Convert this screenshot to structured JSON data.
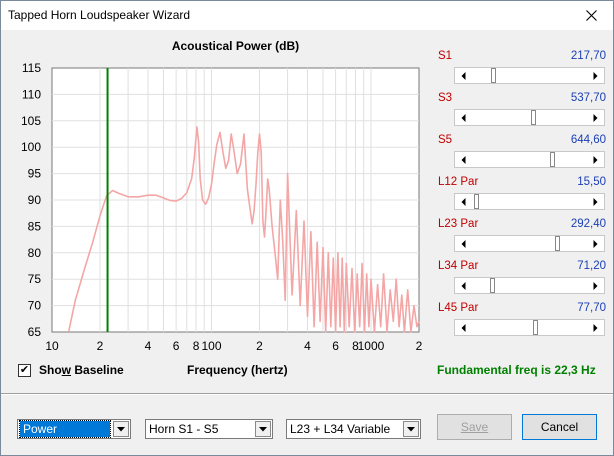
{
  "window": {
    "title": "Tapped Horn Loudspeaker Wizard"
  },
  "chart_data": {
    "type": "line",
    "title": "Acoustical Power (dB)",
    "xlabel": "Frequency (hertz)",
    "ylabel": "",
    "xscale": "log",
    "xlim": [
      10,
      2000
    ],
    "ylim": [
      65,
      115
    ],
    "yticks": [
      115,
      110,
      105,
      100,
      95,
      90,
      85,
      80,
      75,
      70,
      65
    ],
    "xtick_labels": [
      {
        "x": 10,
        "label": "10"
      },
      {
        "x": 20,
        "label": "2"
      },
      {
        "x": 40,
        "label": "4"
      },
      {
        "x": 60,
        "label": "6"
      },
      {
        "x": 80,
        "label": "8"
      },
      {
        "x": 100,
        "label": "100"
      },
      {
        "x": 200,
        "label": "2"
      },
      {
        "x": 400,
        "label": "4"
      },
      {
        "x": 600,
        "label": "6"
      },
      {
        "x": 800,
        "label": "8"
      },
      {
        "x": 1000,
        "label": "1000"
      },
      {
        "x": 2000,
        "label": "2"
      }
    ],
    "grid": true,
    "marker_frequency": 22.3,
    "series": [
      {
        "color": "#f4a6a6",
        "x": [
          12.7,
          14,
          16,
          18,
          20,
          22,
          24,
          26,
          30,
          35,
          40,
          45,
          50,
          55,
          60,
          65,
          70,
          75,
          78,
          81,
          83,
          85,
          88,
          92,
          96,
          100,
          104,
          108,
          113,
          118,
          123,
          128,
          133,
          138,
          145,
          152,
          160,
          168,
          175,
          180,
          185,
          190,
          195,
          200,
          205,
          210,
          215,
          220,
          225,
          230,
          240,
          250,
          260,
          270,
          280,
          290,
          300,
          320,
          340,
          360,
          380,
          400,
          420,
          440,
          460,
          480,
          500,
          520,
          540,
          560,
          580,
          600,
          620,
          640,
          660,
          680,
          700,
          730,
          760,
          790,
          820,
          850,
          880,
          910,
          940,
          970,
          1000,
          1050,
          1100,
          1150,
          1200,
          1260,
          1320,
          1380,
          1440,
          1500,
          1560,
          1620,
          1700,
          1780,
          1860,
          1940,
          2000
        ],
        "y": [
          65,
          71,
          77,
          82,
          87,
          90.8,
          91.8,
          91.3,
          90.6,
          90.6,
          90.9,
          90.9,
          90.4,
          89.9,
          89.8,
          90.3,
          91.4,
          94,
          98,
          103.8,
          101,
          94,
          90,
          89.2,
          90.5,
          93,
          97,
          100.5,
          102.8,
          99,
          96,
          97.5,
          102.5,
          99.5,
          95,
          96.8,
          102.5,
          92,
          88,
          85.5,
          88,
          93,
          99,
          102.5,
          99,
          86,
          83,
          88,
          94,
          92,
          85,
          80,
          75,
          90,
          82,
          71,
          95,
          72,
          88,
          70,
          86,
          68,
          84,
          66,
          82,
          67,
          81,
          65,
          80,
          66,
          79,
          65,
          80,
          66,
          79,
          65,
          78,
          66,
          77,
          65,
          76,
          66,
          78,
          65,
          76,
          66,
          75,
          65,
          74,
          66,
          76,
          65,
          73,
          67,
          75,
          66,
          72,
          65,
          73,
          65,
          70,
          66,
          67
        ]
      }
    ]
  },
  "params": [
    {
      "label": "S1",
      "value": "217,70",
      "position": 0.17
    },
    {
      "label": "S3",
      "value": "537,70",
      "position": 0.54
    },
    {
      "label": "S5",
      "value": "644,60",
      "position": 0.71
    },
    {
      "label": "L12  Par",
      "value": "15,50",
      "position": 0.02
    },
    {
      "label": "L23  Par",
      "value": "292,40",
      "position": 0.75
    },
    {
      "label": "L34  Par",
      "value": "71,20",
      "position": 0.16
    },
    {
      "label": "L45  Par",
      "value": "77,70",
      "position": 0.55
    }
  ],
  "show_baseline": {
    "label_pre": "Sho",
    "label_access": "w",
    "label_post": " Baseline",
    "checked": true,
    "check_glyph": "✔"
  },
  "frequency_label": "Frequency (hertz)",
  "fundamental": "Fundamental freq is 22,3 Hz",
  "combos": [
    {
      "value": "Power"
    },
    {
      "value": "Horn S1 - S5"
    },
    {
      "value": "L23 + L34 Variable"
    }
  ],
  "buttons": {
    "save": "Save",
    "cancel": "Cancel"
  },
  "icons": {
    "close": "close-icon",
    "dropdown": "chevron-down-icon"
  },
  "colors": {
    "curve": "#f4a6a6",
    "marker": "#008000",
    "value_blue": "#1a3fb5",
    "label_red": "#c00000",
    "accent": "#0078d7"
  }
}
